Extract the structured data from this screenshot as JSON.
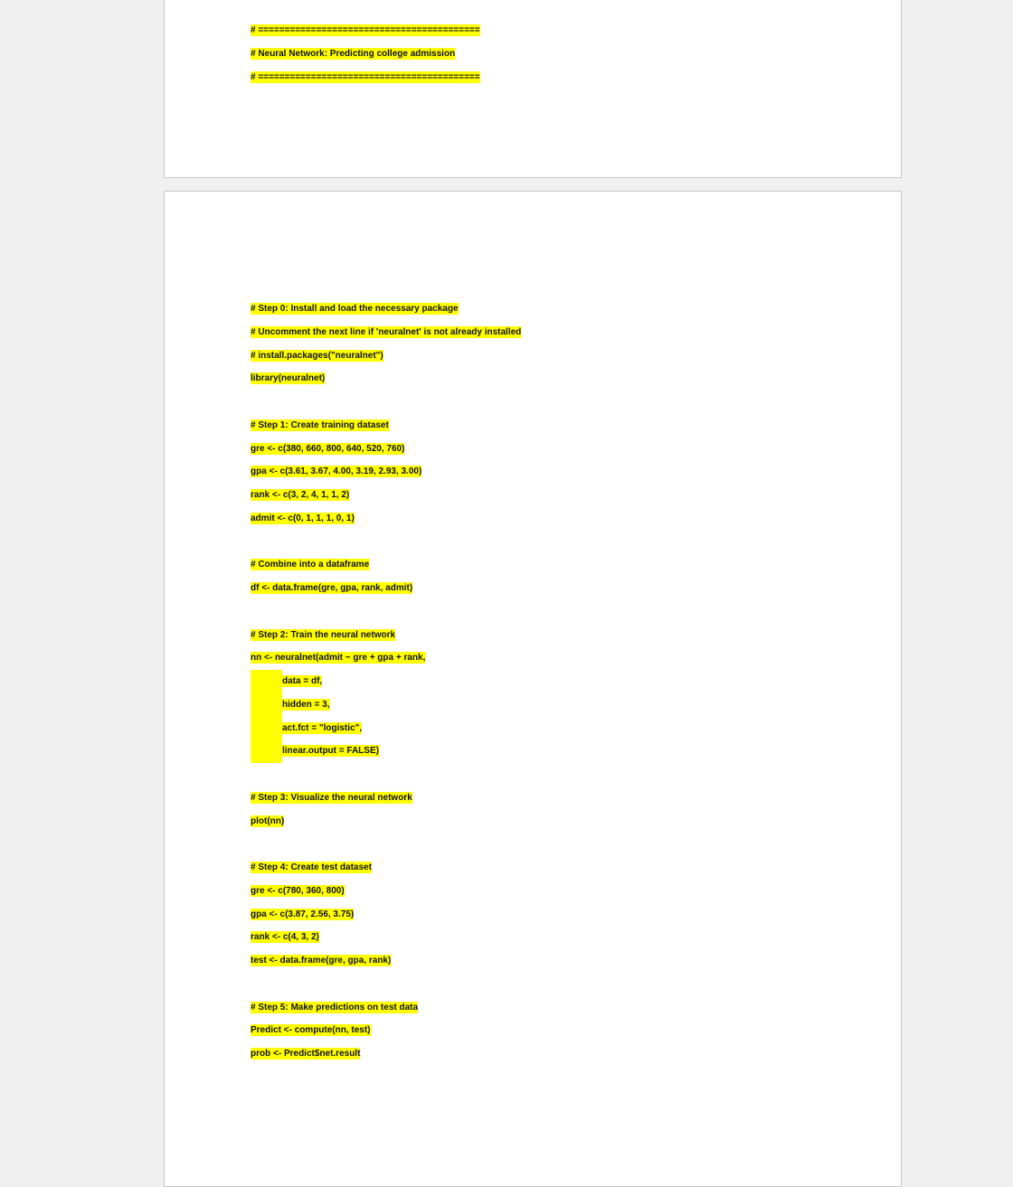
{
  "page1": {
    "lines": [
      "# ==========================================",
      "# Neural Network: Predicting college admission",
      "# =========================================="
    ]
  },
  "page2": {
    "lines": [
      {
        "text": "# Step 0: Install and load the necessary package",
        "indent": false
      },
      {
        "text": "# Uncomment the next line if 'neuralnet' is not already installed",
        "indent": false
      },
      {
        "text": "# install.packages(\"neuralnet\")",
        "indent": false
      },
      {
        "text": "library(neuralnet)",
        "indent": false
      },
      {
        "text": "",
        "indent": false
      },
      {
        "text": "# Step 1: Create training dataset",
        "indent": false
      },
      {
        "text": "gre <- c(380, 660, 800, 640, 520, 760)",
        "indent": false
      },
      {
        "text": "gpa <- c(3.61, 3.67, 4.00, 3.19, 2.93, 3.00)",
        "indent": false
      },
      {
        "text": "rank <- c(3, 2, 4, 1, 1, 2)",
        "indent": false
      },
      {
        "text": "admit <- c(0, 1, 1, 1, 0, 1)",
        "indent": false
      },
      {
        "text": "",
        "indent": false
      },
      {
        "text": "# Combine into a dataframe",
        "indent": false
      },
      {
        "text": "df <- data.frame(gre, gpa, rank, admit)",
        "indent": false
      },
      {
        "text": "",
        "indent": false
      },
      {
        "text": "# Step 2: Train the neural network",
        "indent": false
      },
      {
        "text": "nn <- neuralnet(admit ~ gre + gpa + rank,",
        "indent": false
      },
      {
        "text": "data = df,",
        "indent": true
      },
      {
        "text": "hidden = 3,",
        "indent": true
      },
      {
        "text": "act.fct = \"logistic\",",
        "indent": true
      },
      {
        "text": "linear.output = FALSE)",
        "indent": true
      },
      {
        "text": "",
        "indent": false
      },
      {
        "text": "# Step 3: Visualize the neural network",
        "indent": false
      },
      {
        "text": "plot(nn)",
        "indent": false
      },
      {
        "text": "",
        "indent": false
      },
      {
        "text": "# Step 4: Create test dataset",
        "indent": false
      },
      {
        "text": "gre <- c(780, 360, 800)",
        "indent": false
      },
      {
        "text": "gpa <- c(3.87, 2.56, 3.75)",
        "indent": false
      },
      {
        "text": "rank <- c(4, 3, 2)",
        "indent": false
      },
      {
        "text": "test <- data.frame(gre, gpa, rank)",
        "indent": false
      },
      {
        "text": "",
        "indent": false
      },
      {
        "text": "# Step 5: Make predictions on test data",
        "indent": false
      },
      {
        "text": "Predict <- compute(nn, test)",
        "indent": false
      },
      {
        "text": "prob <- Predict$net.result",
        "indent": false
      }
    ]
  },
  "colors": {
    "highlight": "#ffff00",
    "background": "#f0f0f0"
  }
}
